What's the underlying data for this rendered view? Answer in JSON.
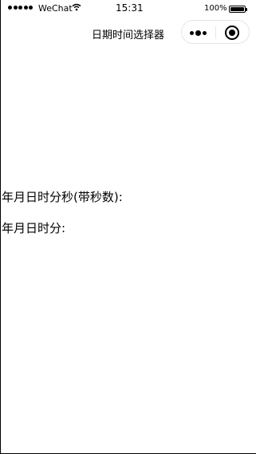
{
  "status_bar": {
    "carrier": "WeChat",
    "time": "15:31",
    "battery_percent": "100%"
  },
  "nav": {
    "title": "日期时间选择器"
  },
  "pickers": [
    {
      "label": "年月日时分秒(带秒数):"
    },
    {
      "label": "年月日时分:"
    }
  ],
  "icons": {
    "signal": "signal-dots-icon",
    "wifi": "wifi-icon",
    "battery": "battery-icon",
    "more": "more-dots-icon",
    "close": "close-target-icon"
  },
  "colors": {
    "background": "#ffffff",
    "text": "#000000",
    "capsule_border": "#e5e5e5"
  }
}
